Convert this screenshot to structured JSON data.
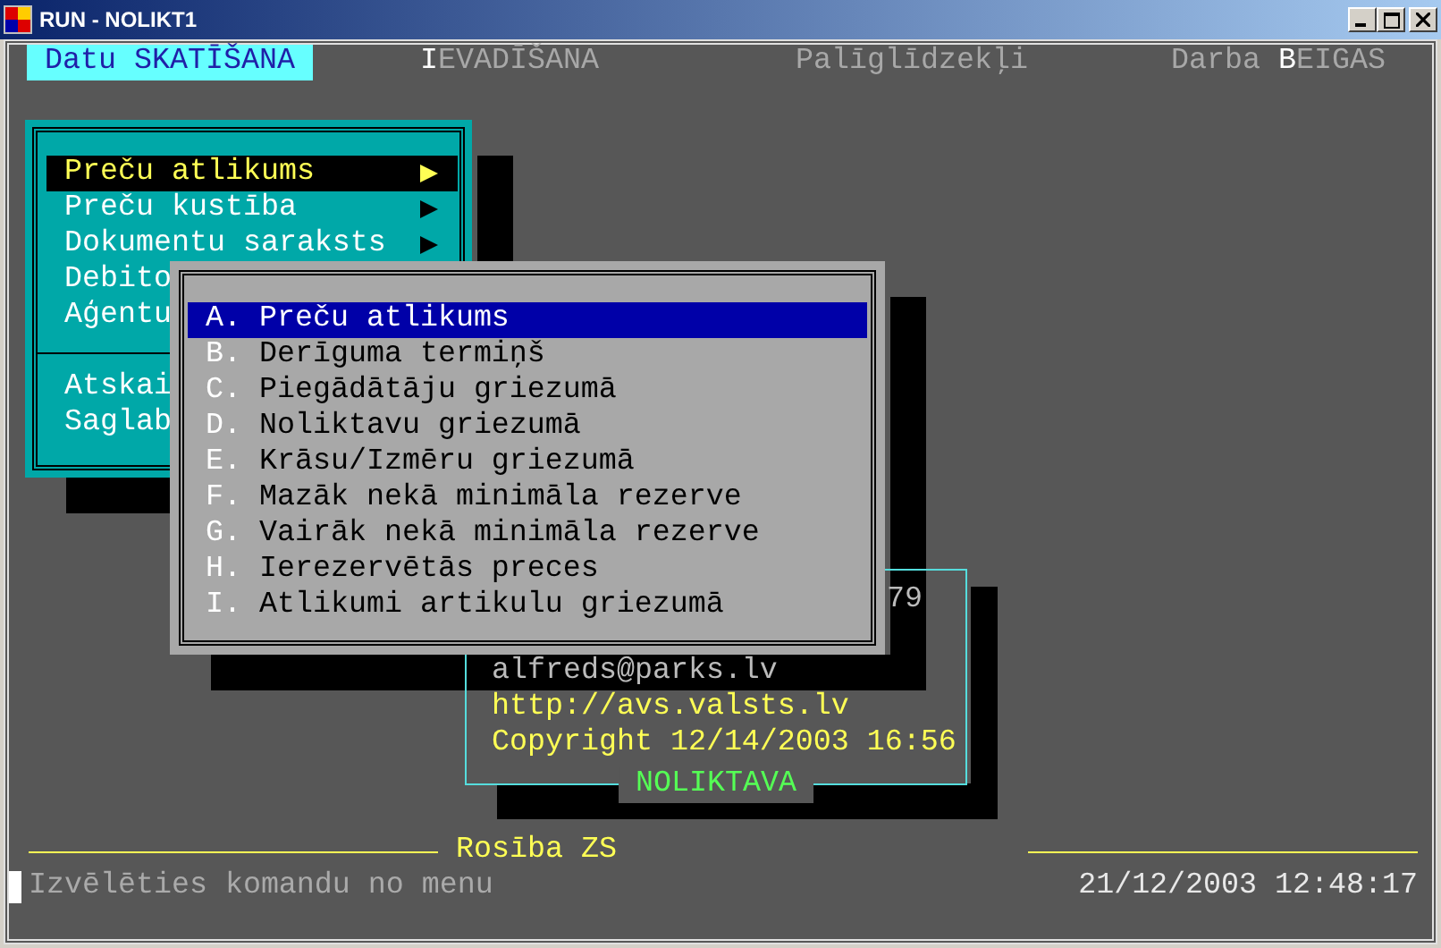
{
  "window": {
    "title": "RUN - NOLIKT1"
  },
  "menu_bar": [
    {
      "label": "Datu SKATĪŠANA",
      "selected": true
    },
    {
      "label": "**I**EVADĪŠANA",
      "selected": false
    },
    {
      "label": "Palīglīdzekļi",
      "selected": false
    },
    {
      "label": "Darba **B**EIGAS",
      "selected": false
    }
  ],
  "main_menu": {
    "items": [
      {
        "kind": "item",
        "label": "Preču atlikums",
        "submenu": true,
        "selected": true
      },
      {
        "kind": "item",
        "label": "Preču kustība",
        "submenu": true,
        "selected": false
      },
      {
        "kind": "item",
        "label": "Dokumentu saraksts",
        "submenu": true,
        "selected": false
      },
      {
        "kind": "item",
        "label": "Debito",
        "selected": false
      },
      {
        "kind": "item",
        "label": "Aģentu",
        "selected": false
      },
      {
        "kind": "separator"
      },
      {
        "kind": "item",
        "label": "Atskai",
        "selected": false
      },
      {
        "kind": "item",
        "label": "Saglab",
        "selected": false
      }
    ]
  },
  "report_menu": {
    "items": [
      {
        "label": "**A.** Preču atlikums",
        "selected": true
      },
      {
        "label": "**B.** Derīguma termiņš",
        "selected": false
      },
      {
        "label": "**C.** Piegādātāju griezumā",
        "selected": false
      },
      {
        "label": "**D.** Noliktavu griezumā",
        "selected": false
      },
      {
        "label": "**E.** Krāsu/Izmēru griezumā",
        "selected": false
      },
      {
        "label": "**F.** Mazāk nekā minimāla rezerve",
        "selected": false
      },
      {
        "label": "**G.** Vairāk nekā minimāla rezerve",
        "selected": false
      },
      {
        "label": "**H.** Ierezervētās preces",
        "selected": false
      },
      {
        "label": "**I.** Atlikumi artikulu griezumā",
        "selected": false
      }
    ]
  },
  "info_box": {
    "title": "NOLIKTAVA",
    "lines": [
      {
        "kind": "tail",
        "text": "79"
      },
      {
        "kind": "plain",
        "text": "alfreds@parks.lv"
      },
      {
        "kind": "accent",
        "text": "http://avs.valsts.lv"
      },
      {
        "kind": "accent",
        "text": "Copyright 12/14/2003 16:56"
      }
    ]
  },
  "status": {
    "title": "Rosība ZS",
    "message": "Izvēlēties komandu no menu",
    "datetime": "21/12/2003 12:48:17"
  }
}
